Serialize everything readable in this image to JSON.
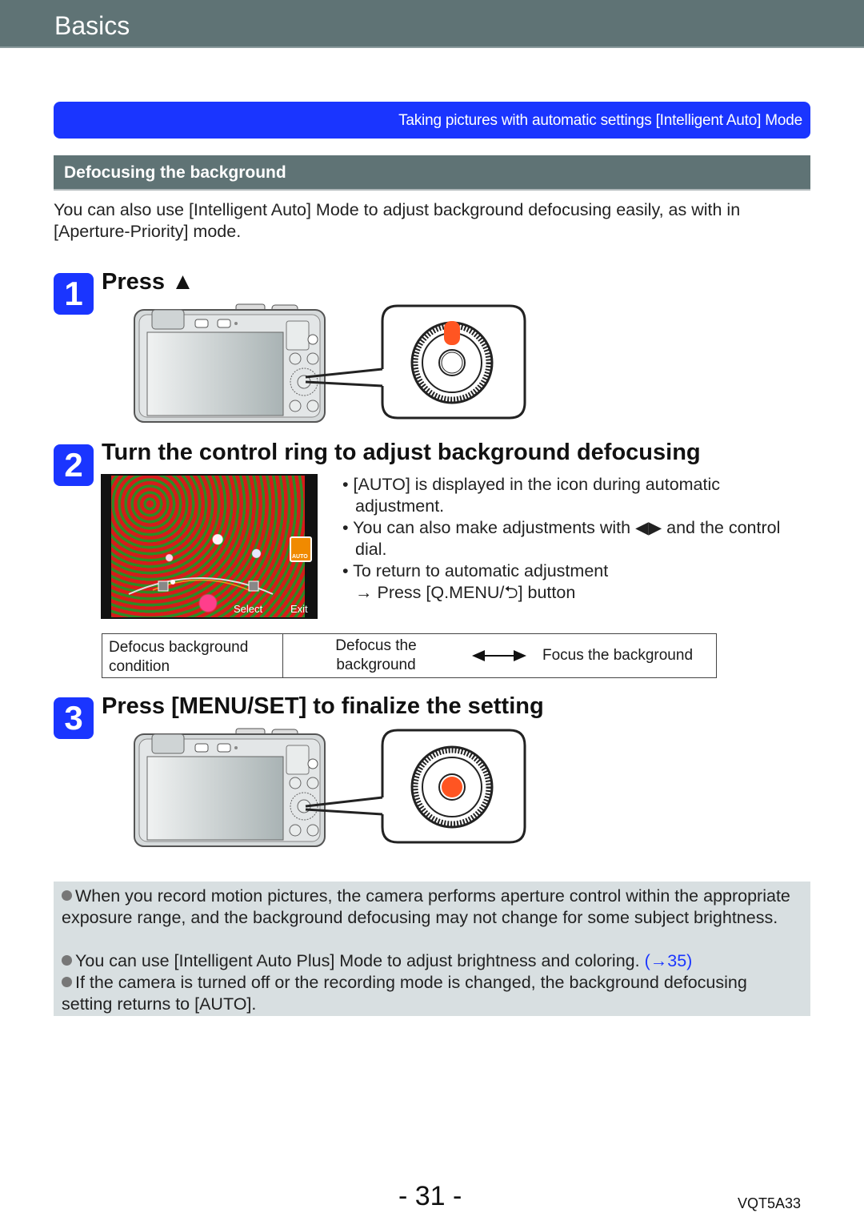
{
  "header": {
    "title": "Basics"
  },
  "breadcrumb": {
    "text": "Taking pictures with automatic settings  [Intelligent Auto] Mode"
  },
  "section": {
    "title": "Defocusing the background"
  },
  "intro": "You can also use [Intelligent Auto] Mode to adjust background defocusing easily, as with in [Aperture-Priority] mode.",
  "steps": [
    {
      "number": "1",
      "title": "Press ▲",
      "highlight": "up-button"
    },
    {
      "number": "2",
      "title": "Turn the control ring to adjust background defocusing"
    },
    {
      "number": "3",
      "title": "Press [MENU/SET] to finalize the setting",
      "highlight": "menu-set-button"
    }
  ],
  "screen": {
    "icon_label": "AUTO",
    "select_label": "Select",
    "exit_label": "Exit"
  },
  "bullets": [
    {
      "text": "[AUTO] is displayed in the icon during automatic adjustment."
    },
    {
      "text": "You can also make adjustments with ◀▶ and the control dial."
    },
    {
      "text": "To return to automatic adjustment",
      "sub": "→ Press [Q.MENU/⮌] button"
    }
  ],
  "table": {
    "label": "Defocus background condition",
    "left": "Defocus the background",
    "right": "Focus the background"
  },
  "notes": [
    {
      "text": "When you record motion pictures, the camera performs aperture control within the appropriate exposure range, and the background defocusing may not change for some subject brightness."
    },
    {
      "text": "You can use [Intelligent Auto Plus] Mode to adjust brightness and coloring.",
      "link": "(→35)"
    },
    {
      "text": "If the camera is turned off or the recording mode is changed, the background defocusing setting returns to [AUTO]."
    }
  ],
  "footer": {
    "page": "- 31 -",
    "code": "VQT5A33"
  },
  "colors": {
    "accent": "#1a35ff",
    "header": "#5f7375",
    "highlight": "#ff5522",
    "notes_bg": "#d8dfe1"
  }
}
